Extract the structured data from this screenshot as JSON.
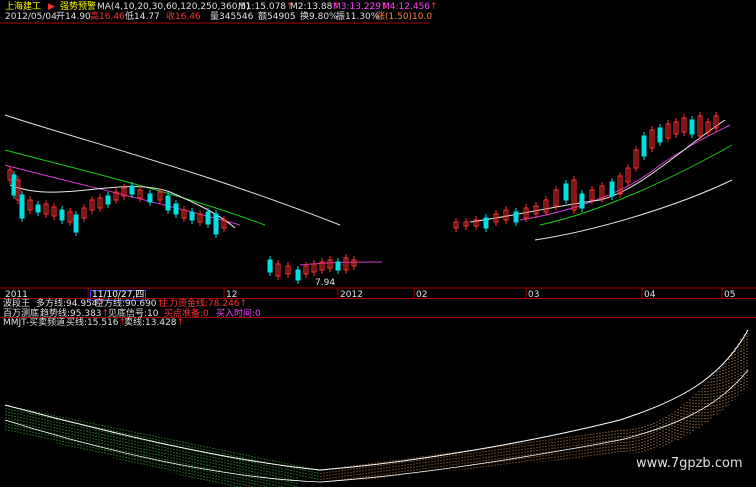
{
  "stock": {
    "name": "上海建工",
    "date": "2012/05/04",
    "indicator_title": "强势预警"
  },
  "ma_line": {
    "label": "MA(4,10,20,30,60,120,250,360,5)",
    "m1": "M1:15.078",
    "m2": "M2:13.88",
    "m3": "M3:13.229",
    "m4": "M4:12.456"
  },
  "quote": {
    "open": "开14.90",
    "high": "高16.46",
    "low": "低14.77",
    "close": "收16.46",
    "volume": "量345546",
    "amount": "额54905",
    "turnover": "换9.80%",
    "amplitude": "振11.30%",
    "change": "涨(1.50)10.0"
  },
  "low_label": "7.94",
  "x_axis": {
    "labels": [
      "2011",
      "11/10/27,四",
      "12",
      "2012",
      "02",
      "03",
      "04",
      "05"
    ]
  },
  "panel2": {
    "row1": {
      "name": "波段王",
      "long_line": "多方线:94.954",
      "short_line": "空方线:90.690",
      "fund_line": "主力资金线:78.246"
    },
    "row2": {
      "name": "百万测底",
      "trend": "趋势线:95.383",
      "signal": "见底信号:10",
      "ready": "买点准备:0",
      "buy_time": "买入时间:0"
    }
  },
  "panel3": {
    "title": "MMJT-买卖频道",
    "buy": "买线:15.516",
    "sell": "卖线:13.428"
  },
  "watermark": "www.7gpzb.com",
  "colors": {
    "background": "#000000",
    "ma_white": "#e8e8e8",
    "ma_green": "#1cc81c",
    "ma_magenta": "#d838d8",
    "separator": "#a00000",
    "up_candle": "#ff3030",
    "down_candle": "#00e0e0"
  },
  "chart_data": {
    "type": "candlestick",
    "x": [
      "2011",
      "11/10/27",
      "12",
      "2012",
      "02",
      "03",
      "04",
      "05"
    ],
    "low_marker": 7.94,
    "last_close": 16.46
  }
}
